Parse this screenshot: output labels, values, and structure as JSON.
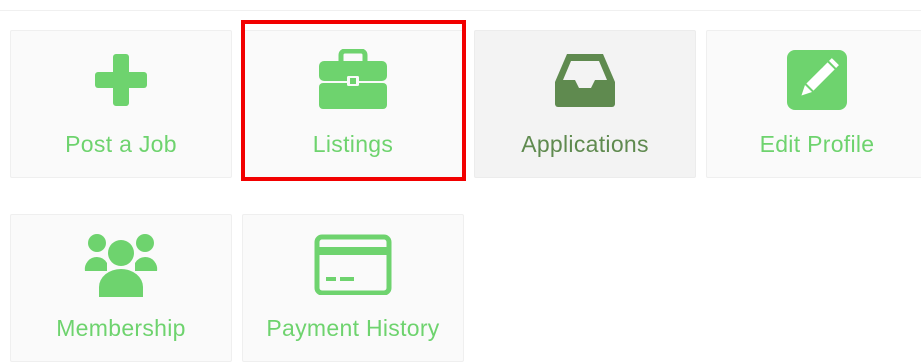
{
  "colors": {
    "accent": "#6ed36e",
    "accent_dark": "#5f8a4f",
    "highlight": "#f20000"
  },
  "tiles": [
    {
      "label": "Post a Job",
      "icon": "plus-icon"
    },
    {
      "label": "Listings",
      "icon": "briefcase-icon"
    },
    {
      "label": "Applications",
      "icon": "inbox-tray-icon"
    },
    {
      "label": "Edit Profile",
      "icon": "pencil-square-icon"
    },
    {
      "label": "Membership",
      "icon": "users-group-icon"
    },
    {
      "label": "Payment History",
      "icon": "credit-card-icon"
    }
  ]
}
